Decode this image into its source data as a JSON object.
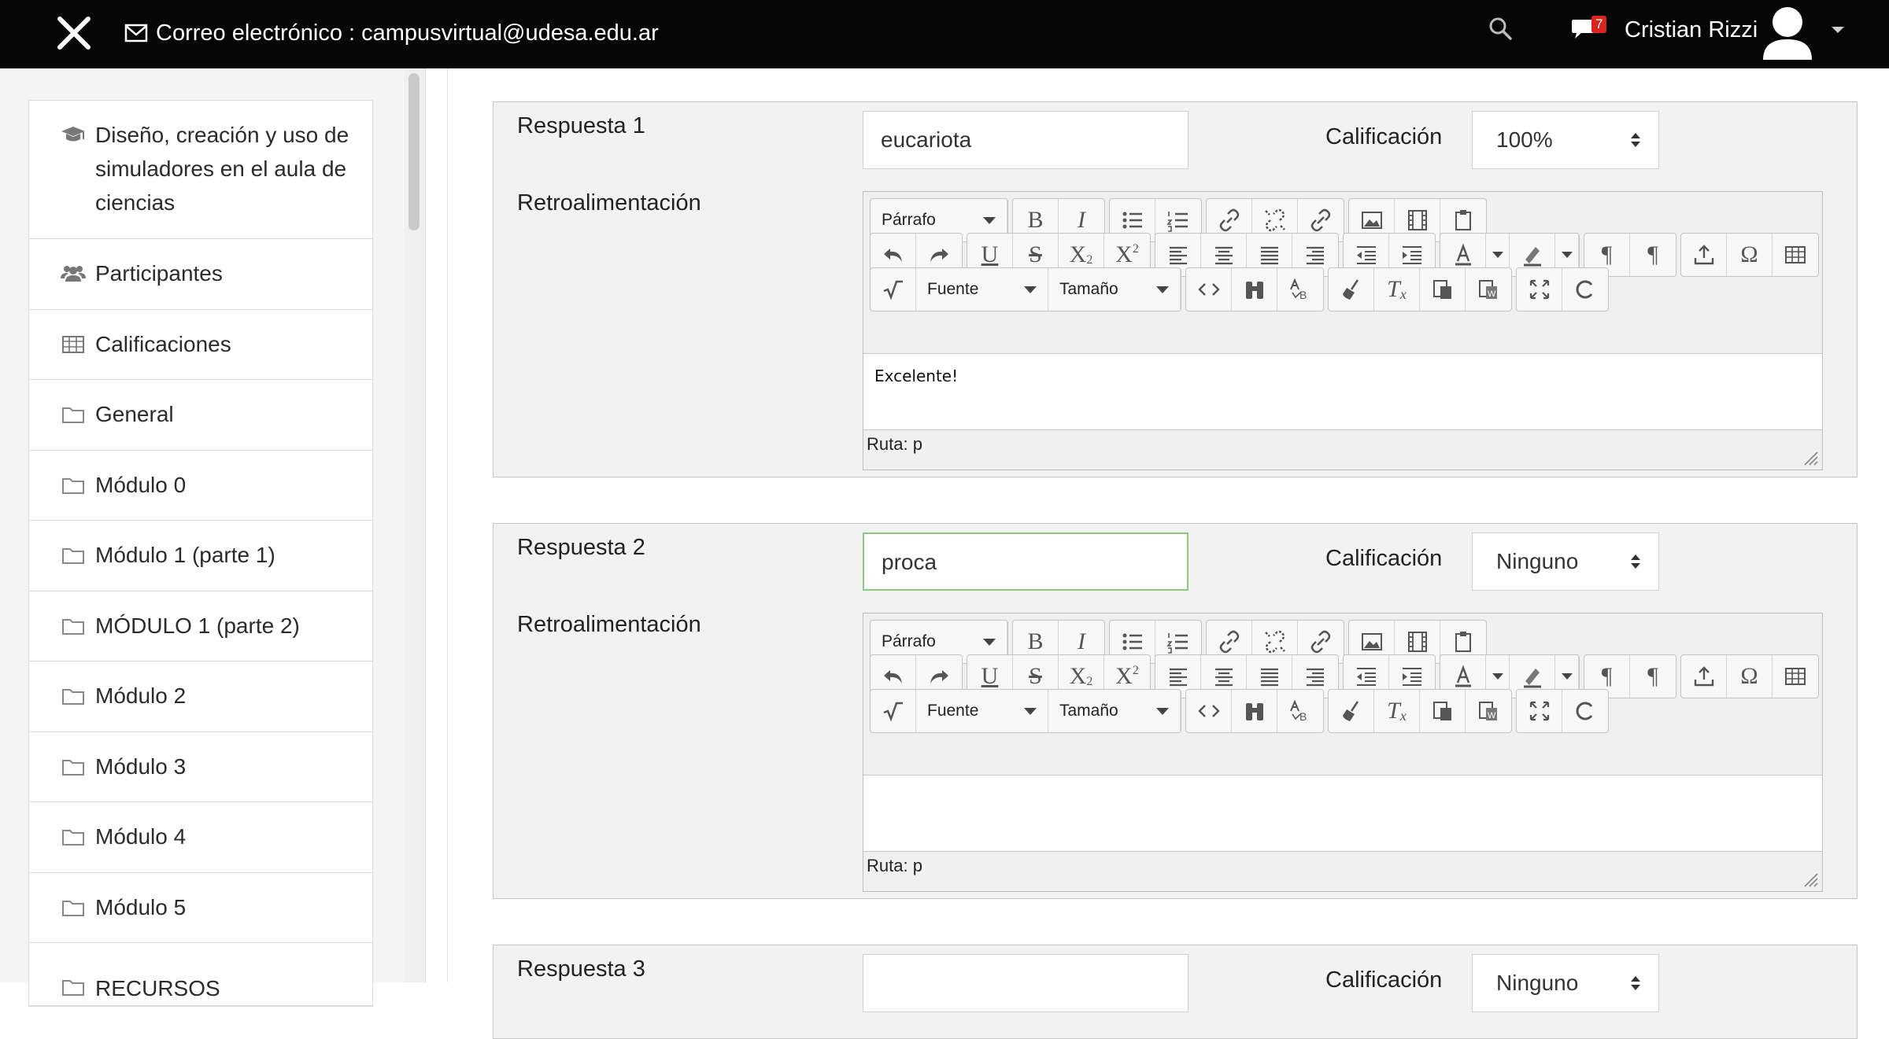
{
  "topbar": {
    "email_label": "Correo electrónico : campusvirtual@udesa.edu.ar",
    "user_name": "Cristian Rizzi",
    "message_count": "7"
  },
  "sidebar": {
    "items": [
      {
        "label": "Diseño, creación y uso de simuladores en el aula de ciencias",
        "icon": "graduation-cap-icon"
      },
      {
        "label": "Participantes",
        "icon": "users-icon"
      },
      {
        "label": "Calificaciones",
        "icon": "table-icon"
      },
      {
        "label": "General",
        "icon": "folder-icon"
      },
      {
        "label": "Módulo 0",
        "icon": "folder-icon"
      },
      {
        "label": "Módulo 1 (parte 1)",
        "icon": "folder-icon"
      },
      {
        "label": "MÓDULO 1 (parte 2)",
        "icon": "folder-icon"
      },
      {
        "label": "Módulo 2",
        "icon": "folder-icon"
      },
      {
        "label": "Módulo 3",
        "icon": "folder-icon"
      },
      {
        "label": "Módulo 4",
        "icon": "folder-icon"
      },
      {
        "label": "Módulo 5",
        "icon": "folder-icon"
      },
      {
        "label": "RECURSOS",
        "icon": "folder-icon"
      }
    ]
  },
  "responses": [
    {
      "label": "Respuesta 1",
      "answer": "eucariota",
      "grade_label": "Calificación",
      "grade": "100%",
      "feedback_label": "Retroalimentación",
      "feedback_text": "Excelente!",
      "path": "Ruta: p"
    },
    {
      "label": "Respuesta 2",
      "answer": "proca",
      "grade_label": "Calificación",
      "grade": "Ninguno",
      "feedback_label": "Retroalimentación",
      "feedback_text": "",
      "path": "Ruta: p"
    },
    {
      "label": "Respuesta 3",
      "answer": "",
      "grade_label": "Calificación",
      "grade": "Ninguno"
    }
  ],
  "editor": {
    "format_select": "Párrafo",
    "font_select": "Fuente",
    "size_select": "Tamaño"
  },
  "colors": {
    "topbar": "#060606",
    "focus_border": "#8cc87e",
    "badge": "#d9251d"
  }
}
